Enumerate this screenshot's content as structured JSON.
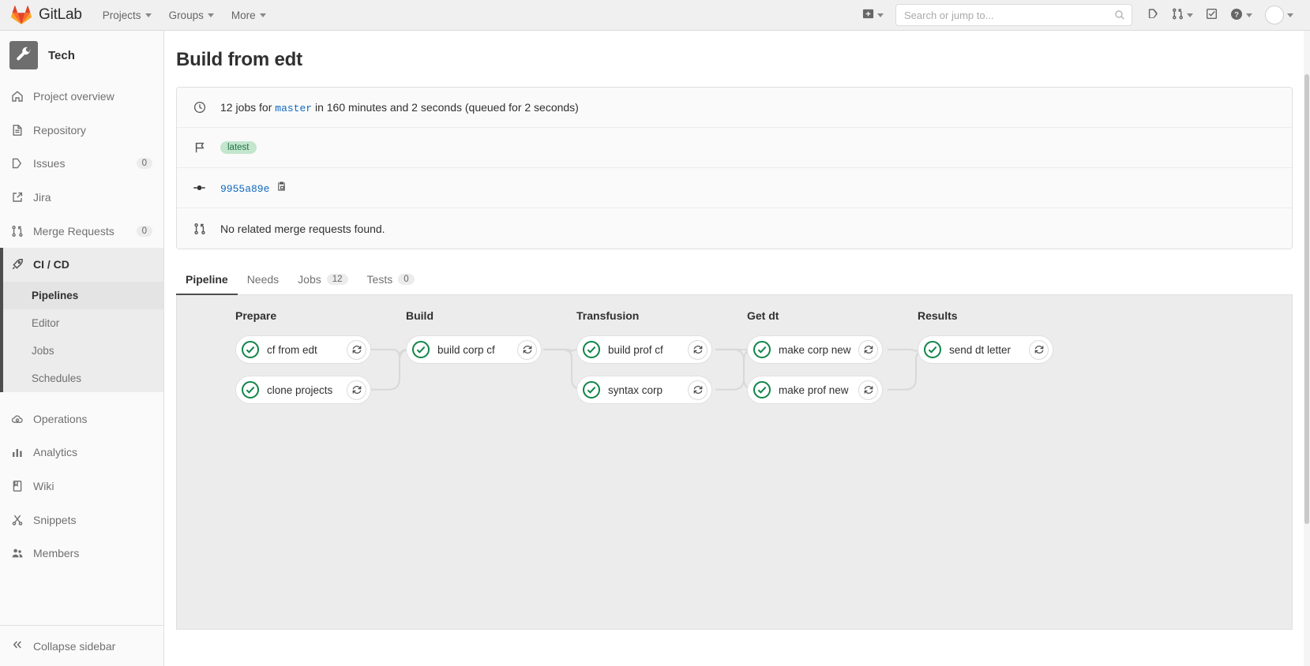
{
  "navbar": {
    "brand": "GitLab",
    "brand_logo_icon": "gitlab-tanuki-logo",
    "links": [
      {
        "label": "Projects",
        "icon": "chevron-down-icon"
      },
      {
        "label": "Groups",
        "icon": "chevron-down-icon"
      },
      {
        "label": "More",
        "icon": "chevron-down-icon"
      }
    ],
    "create_new_icon": "plus-square-icon",
    "search": {
      "placeholder": "Search or jump to...",
      "value": "",
      "icon": "search-icon"
    },
    "right_icons": [
      {
        "name": "issues-icon",
        "label": "Issues"
      },
      {
        "name": "merge-requests-icon",
        "label": "Merge requests"
      },
      {
        "name": "todos-icon",
        "label": "To-Do List"
      },
      {
        "name": "help-icon",
        "label": "Help"
      },
      {
        "name": "user-avatar",
        "label": "User menu"
      }
    ]
  },
  "sidebar": {
    "project": {
      "name": "Tech",
      "avatar_icon": "wrench-icon"
    },
    "items": [
      {
        "label": "Project overview",
        "icon": "home-icon",
        "badge": null,
        "active": false
      },
      {
        "label": "Repository",
        "icon": "document-icon",
        "badge": null,
        "active": false
      },
      {
        "label": "Issues",
        "icon": "issues-icon",
        "badge": "0",
        "active": false
      },
      {
        "label": "Jira",
        "icon": "external-link-icon",
        "badge": null,
        "active": false
      },
      {
        "label": "Merge Requests",
        "icon": "merge-request-icon",
        "badge": "0",
        "active": false
      },
      {
        "label": "CI / CD",
        "icon": "rocket-icon",
        "badge": null,
        "active": true
      },
      {
        "label": "Operations",
        "icon": "cloud-gear-icon",
        "badge": null,
        "active": false
      },
      {
        "label": "Analytics",
        "icon": "chart-icon",
        "badge": null,
        "active": false
      },
      {
        "label": "Wiki",
        "icon": "book-icon",
        "badge": null,
        "active": false
      },
      {
        "label": "Snippets",
        "icon": "scissors-icon",
        "badge": null,
        "active": false
      },
      {
        "label": "Members",
        "icon": "users-icon",
        "badge": null,
        "active": false
      }
    ],
    "subitems": [
      {
        "label": "Pipelines",
        "current": true
      },
      {
        "label": "Editor",
        "current": false
      },
      {
        "label": "Jobs",
        "current": false
      },
      {
        "label": "Schedules",
        "current": false
      }
    ],
    "collapse": {
      "label": "Collapse sidebar",
      "icon": "double-chevron-left-icon"
    }
  },
  "page": {
    "title": "Build from edt",
    "info_rows": [
      {
        "icon": "clock-icon",
        "prefix": "12 jobs for ",
        "ref": "master",
        "suffix": " in 160 minutes and 2 seconds (queued for 2 seconds)"
      },
      {
        "icon": "flag-icon",
        "tag": "latest"
      },
      {
        "icon": "commit-icon",
        "sha": "9955a89e",
        "copy_icon": "copy-to-clipboard-icon"
      },
      {
        "icon": "merge-request-icon",
        "text": "No related merge requests found."
      }
    ],
    "tabs": [
      {
        "label": "Pipeline",
        "badge": null,
        "active": true
      },
      {
        "label": "Needs",
        "badge": null,
        "active": false
      },
      {
        "label": "Jobs",
        "badge": "12",
        "active": false
      },
      {
        "label": "Tests",
        "badge": "0",
        "active": false
      }
    ]
  },
  "pipeline": {
    "status_icon": "status-success-icon",
    "retry_icon": "retry-icon",
    "stages": [
      {
        "name": "Prepare",
        "jobs": [
          {
            "name": "cf from edt",
            "status": "success"
          },
          {
            "name": "clone projects",
            "status": "success"
          }
        ]
      },
      {
        "name": "Build",
        "jobs": [
          {
            "name": "build corp cf",
            "status": "success"
          }
        ]
      },
      {
        "name": "Transfusion",
        "jobs": [
          {
            "name": "build prof cf",
            "status": "success"
          },
          {
            "name": "syntax corp",
            "status": "success"
          }
        ]
      },
      {
        "name": "Get dt",
        "jobs": [
          {
            "name": "make corp new",
            "status": "success"
          },
          {
            "name": "make prof new",
            "status": "success"
          }
        ]
      },
      {
        "name": "Results",
        "jobs": [
          {
            "name": "send dt letter",
            "status": "success"
          }
        ]
      }
    ]
  },
  "colors": {
    "success_green": "#108548",
    "link_blue": "#1068bf",
    "tag_bg": "#c3e6cd",
    "tag_fg": "#217645",
    "graph_bg": "#ececec"
  }
}
